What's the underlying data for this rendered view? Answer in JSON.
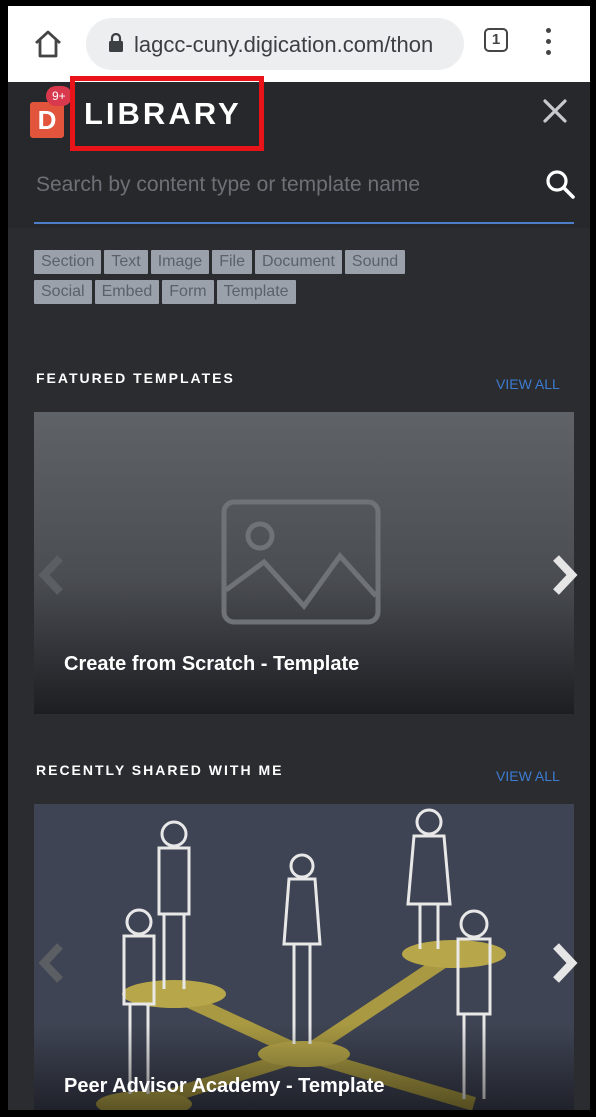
{
  "browser": {
    "url": "lagcc-cuny.digication.com/thon",
    "tab_count": "1"
  },
  "library": {
    "logo_letter": "D",
    "badge": "9+",
    "title": "LIBRARY",
    "search_placeholder": "Search by content type or template name"
  },
  "filters": [
    "Section",
    "Text",
    "Image",
    "File",
    "Document",
    "Sound",
    "Social",
    "Embed",
    "Form",
    "Template"
  ],
  "featured": {
    "heading": "FEATURED TEMPLATES",
    "view_all": "VIEW ALL",
    "card_title": "Create from Scratch - Template"
  },
  "shared": {
    "heading": "RECENTLY SHARED WITH ME",
    "view_all": "VIEW ALL",
    "card_title": "Peer Advisor Academy - Template"
  },
  "colors": {
    "panel": "#26282c",
    "accent_blue": "#3d7bd0",
    "logo_red": "#e2543b",
    "highlight_red": "#e8141a"
  }
}
